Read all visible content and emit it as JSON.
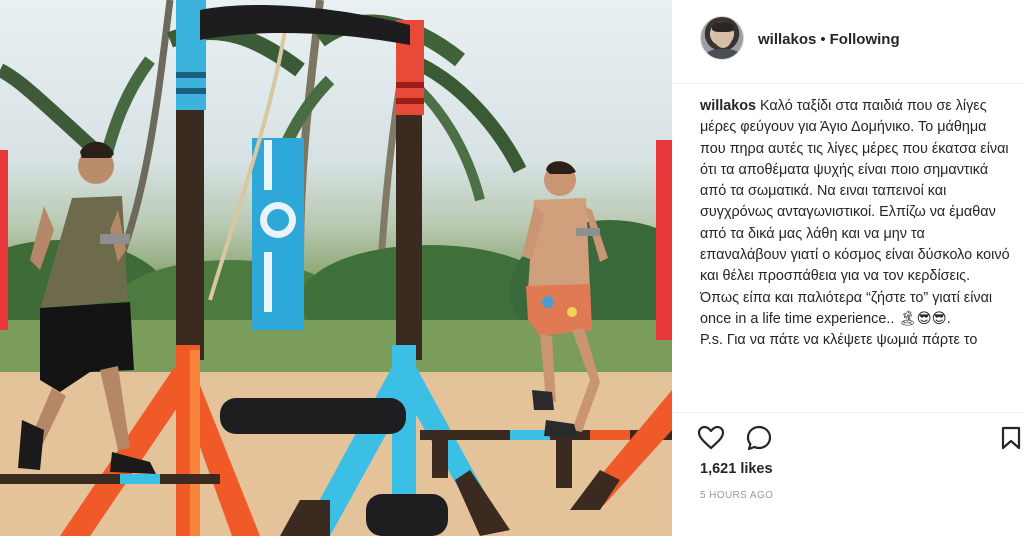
{
  "post": {
    "username": "willakos",
    "separator": "•",
    "follow_status": "Following",
    "caption_user": "willakos",
    "caption_paragraphs": [
      "Καλό ταξίδι στα παιδιά που σε λίγες μέρες φεύγουν για Άγιο Δομήνικο. Το μάθημα που πηρα αυτές τις λίγες μέρες που έκατσα είναι ότι τα αποθέματα ψυχής είναι ποιο σημαντικά από τα σωματικά. Να ειναι ταπεινοί και συγχρόνως ανταγωνιστικοί. Ελπίζω να έμαθαν από τα δικά μας λάθη και να μην τα επαναλάβουν γιατί ο κόσμος είναι δύσκολο κοινό και θέλει προσπάθεια για να τον κερδίσεις. Όπως είπα και παλιότερα “ζήστε το” γιατί είναι once in a life time experience.. 🏝😎😎.",
      "P.s. Για να πάτε να κλέψετε ψωμιά πάρτε το"
    ],
    "likes": "1,621 likes",
    "timestamp": "5 HOURS AGO"
  },
  "icons": {
    "like": "heart-icon",
    "comment": "comment-icon",
    "save": "bookmark-icon"
  },
  "colors": {
    "text": "#262626",
    "muted": "#999999",
    "divider": "#efefef"
  }
}
